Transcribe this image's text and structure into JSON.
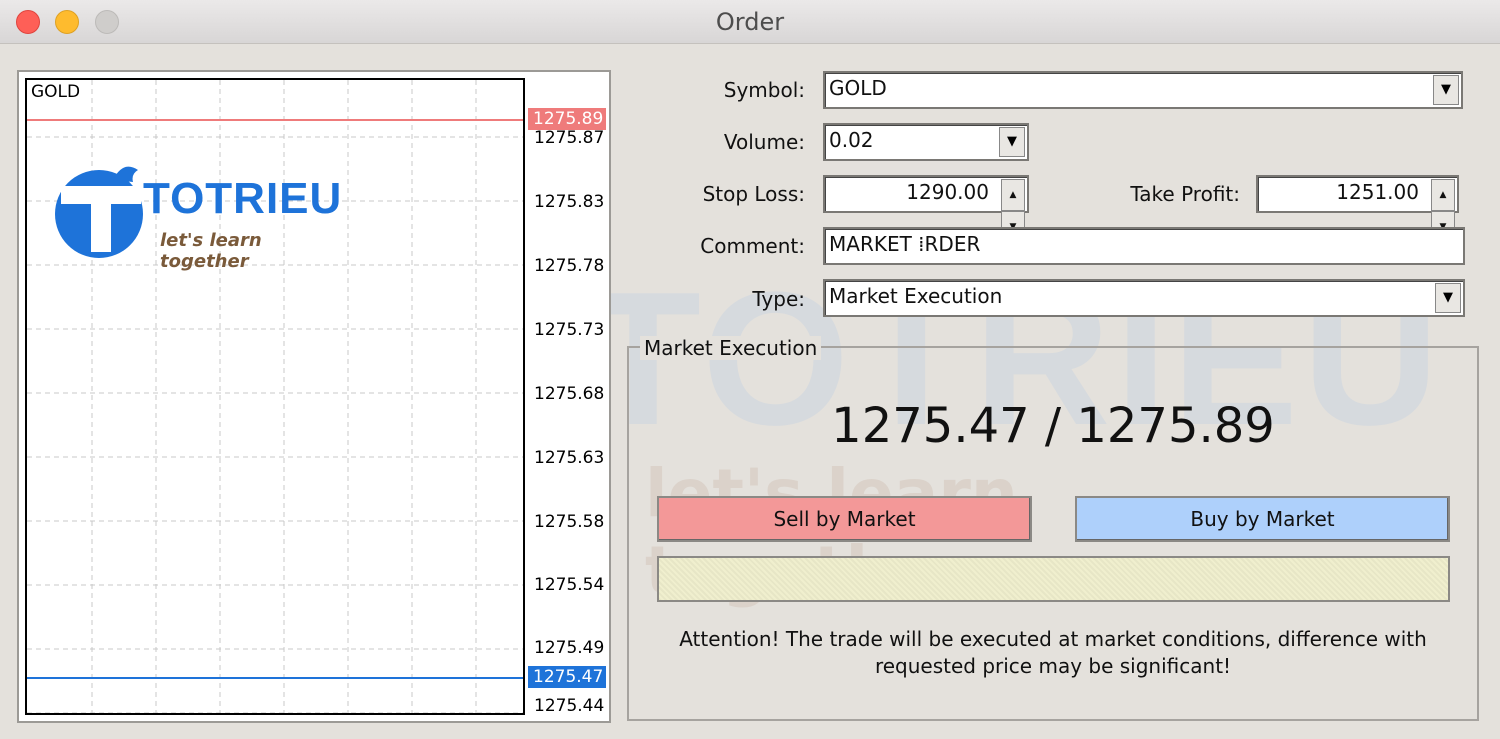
{
  "window": {
    "title": "Order"
  },
  "chart": {
    "symbol": "GOLD",
    "price_labels": [
      "1275.87",
      "1275.83",
      "1275.78",
      "1275.73",
      "1275.68",
      "1275.63",
      "1275.58",
      "1275.54",
      "1275.49",
      "1275.44"
    ],
    "ask_price": "1275.89",
    "bid_price": "1275.47",
    "ask_color": "#ef7b7b",
    "bid_color": "#1e73d9",
    "grid": "dashed"
  },
  "logo": {
    "name": "TOTRIEU",
    "tagline": "let's learn together"
  },
  "watermark": {
    "name": "TOTRIEU",
    "tagline": "let's learn together"
  },
  "form": {
    "symbol_label": "Symbol:",
    "symbol_value": "GOLD",
    "volume_label": "Volume:",
    "volume_value": "0.02",
    "stop_loss_label": "Stop Loss:",
    "stop_loss_value": "1290.00",
    "take_profit_label": "Take Profit:",
    "take_profit_value": "1251.00",
    "comment_label": "Comment:",
    "comment_value": "MARKET ⁞RDER",
    "type_label": "Type:",
    "type_value": "Market Execution"
  },
  "execution": {
    "group_title": "Market Execution",
    "quote": "1275.47 / 1275.89",
    "sell_label": "Sell by Market",
    "buy_label": "Buy by Market",
    "attention_line1": "Attention! The trade will be executed at market conditions, difference with",
    "attention_line2": "requested price may be significant!"
  }
}
